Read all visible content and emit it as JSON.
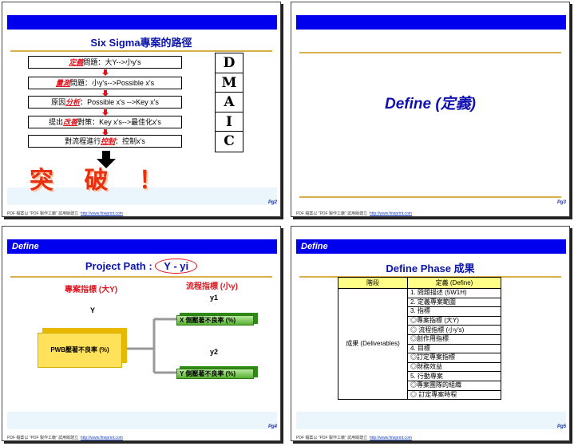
{
  "slide1": {
    "title": "Six Sigma專案的路徑",
    "steps": [
      {
        "red": "定義",
        "rest": "問題：大Y-->小y's"
      },
      {
        "red": "量測",
        "rest": "問題：小y's-->Possible x's"
      },
      {
        "pre": "原因",
        "red": "分析",
        "rest": "：Possible x's -->Key x's"
      },
      {
        "pre": "提出",
        "red": "改善",
        "rest": "對策：Key x's-->最佳化x's"
      },
      {
        "pre": "對流程進行",
        "red": "控制",
        "rest": "：控制x's"
      }
    ],
    "dmaic": [
      "D",
      "M",
      "A",
      "I",
      "C"
    ],
    "breakthrough": "突 破 ！",
    "page": "Pg2"
  },
  "slide2": {
    "title": "Define (定義)",
    "page": "Pg3"
  },
  "slide3": {
    "header": "Define",
    "title_a": "Project Path :",
    "title_b": "Y - yi",
    "label_project": "專案指標 (大Y)",
    "label_process": "流程指標 (小y)",
    "y": "Y",
    "y1": "y1",
    "y2": "y2",
    "main_box": "PWB壓著不良率 (%)",
    "x_box": "X 側壓著不良率 (%)",
    "y_box": "Y 側壓著不良率 (%)",
    "page": "Pg4"
  },
  "slide4": {
    "header": "Define",
    "title": "Define Phase 成果",
    "col_stage": "階段",
    "col_def": "定義 (Define)",
    "stage": "成果 (Deliverables)",
    "rows": [
      "1. 問題描述 (5W1H)",
      "2. 定義專案範圍",
      "3. 指標",
      "◎專案指標 (大Y)",
      "◎ 流程指標 (小y's)",
      "◎創作用指標",
      "4. 目標",
      "◎訂定專案指標",
      "◎財務效益",
      "5. 行動專案",
      "◎專案團隊的組織",
      "◎ 訂定專案時程"
    ],
    "page": "Pg5"
  },
  "footer_text": "PDF 檔案以 \"PDF 製作工廠\" 試用版建立",
  "footer_link": "http://www.fineprint.com",
  "colors": {
    "bar": "#0000ee",
    "gold": "#d7b04a",
    "red": "#e0141e",
    "title": "#0a14a8"
  }
}
